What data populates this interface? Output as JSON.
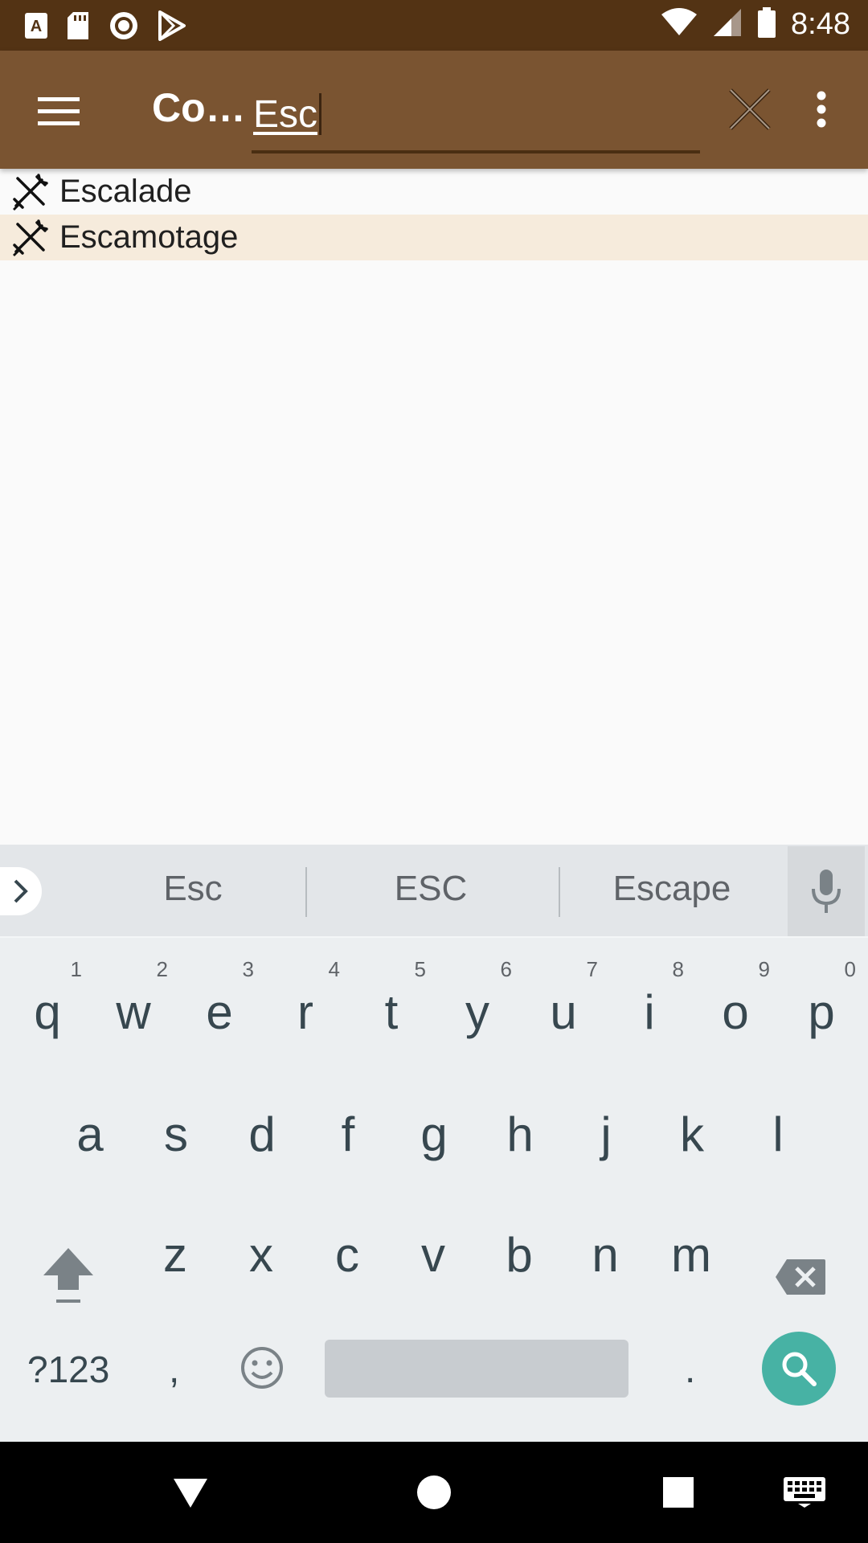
{
  "status_bar": {
    "time": "8:48",
    "left_icons": [
      "a-notification-icon",
      "sd-card-icon",
      "record-icon",
      "play-store-icon"
    ],
    "right_icons": [
      "wifi-icon",
      "signal-icon",
      "battery-icon"
    ]
  },
  "app_bar": {
    "title": "Co…",
    "search_value": "Esc",
    "background": "#7a5431",
    "status_background": "#533314"
  },
  "results": [
    {
      "label": "Escalade",
      "icon": "crossed-tools-icon",
      "highlighted": false
    },
    {
      "label": "Escamotage",
      "icon": "crossed-tools-icon",
      "highlighted": true
    }
  ],
  "keyboard": {
    "suggestions": [
      "Esc",
      "ESC",
      "Escape"
    ],
    "row1": [
      {
        "k": "q",
        "n": "1"
      },
      {
        "k": "w",
        "n": "2"
      },
      {
        "k": "e",
        "n": "3"
      },
      {
        "k": "r",
        "n": "4"
      },
      {
        "k": "t",
        "n": "5"
      },
      {
        "k": "y",
        "n": "6"
      },
      {
        "k": "u",
        "n": "7"
      },
      {
        "k": "i",
        "n": "8"
      },
      {
        "k": "o",
        "n": "9"
      },
      {
        "k": "p",
        "n": "0"
      }
    ],
    "row2": [
      "a",
      "s",
      "d",
      "f",
      "g",
      "h",
      "j",
      "k",
      "l"
    ],
    "row3": [
      "z",
      "x",
      "c",
      "v",
      "b",
      "n",
      "m"
    ],
    "symbols_label": "?123",
    "comma": ",",
    "period": ".",
    "accent": "#47b2a4"
  },
  "nav_bar": {
    "buttons": [
      "back-icon",
      "home-icon",
      "recents-icon",
      "keyboard-switch-icon"
    ]
  }
}
